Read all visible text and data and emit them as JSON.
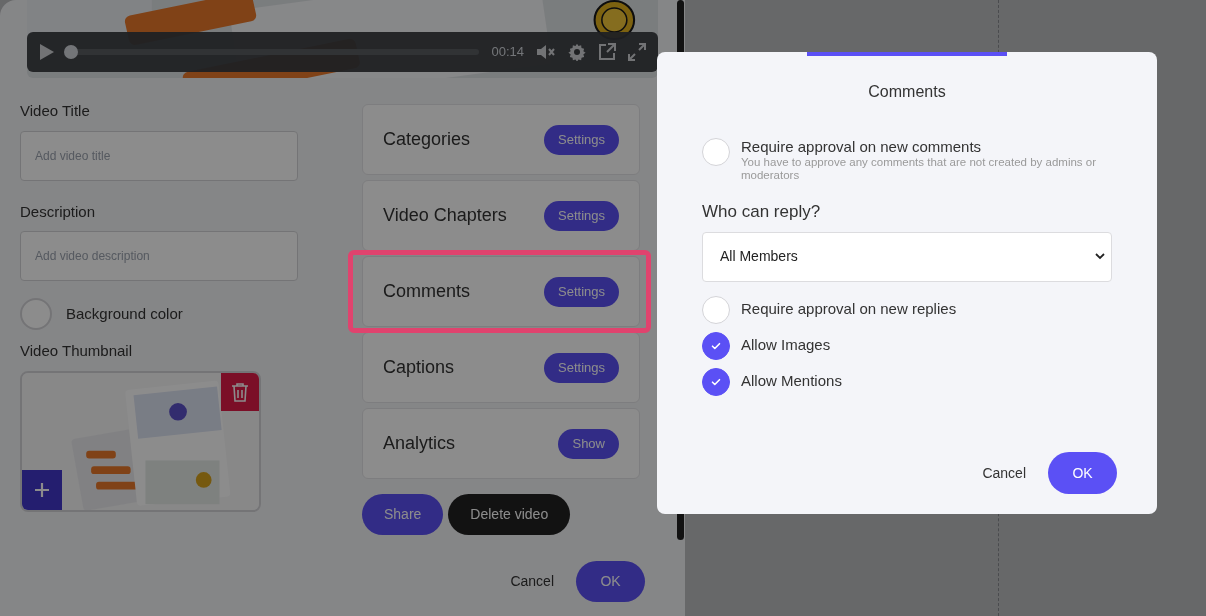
{
  "video_player": {
    "time": "00:14",
    "level": 0.01
  },
  "form": {
    "title_field": {
      "label": "Video Title",
      "placeholder": "Add video title"
    },
    "description_field": {
      "label": "Description",
      "placeholder": "Add video description"
    },
    "background_color": {
      "label": "Background color"
    },
    "thumbnail": {
      "label": "Video Thumbnail"
    }
  },
  "settings_cards": [
    {
      "title": "Categories",
      "button": "Settings",
      "highlighted": false
    },
    {
      "title": "Video Chapters",
      "button": "Settings",
      "highlighted": false
    },
    {
      "title": "Comments",
      "button": "Settings",
      "highlighted": true
    },
    {
      "title": "Captions",
      "button": "Settings",
      "highlighted": false
    },
    {
      "title": "Analytics",
      "button": "Show",
      "highlighted": false
    }
  ],
  "actions": [
    "Share",
    "Delete video"
  ],
  "footer": {
    "cancel": "Cancel",
    "ok": "OK"
  },
  "modal": {
    "title": "Comments",
    "approval": {
      "label": "Require approval on new comments",
      "description": "You have to approve any comments that are not created by admins or moderators",
      "checked": false
    },
    "who_can_reply": {
      "label": "Who can reply?",
      "value": "All Members"
    },
    "options": [
      {
        "label": "Require approval on new replies",
        "checked": false
      },
      {
        "label": "Allow Images",
        "checked": true
      },
      {
        "label": "Allow Mentions",
        "checked": true
      }
    ],
    "cancel": "Cancel",
    "ok": "OK"
  }
}
